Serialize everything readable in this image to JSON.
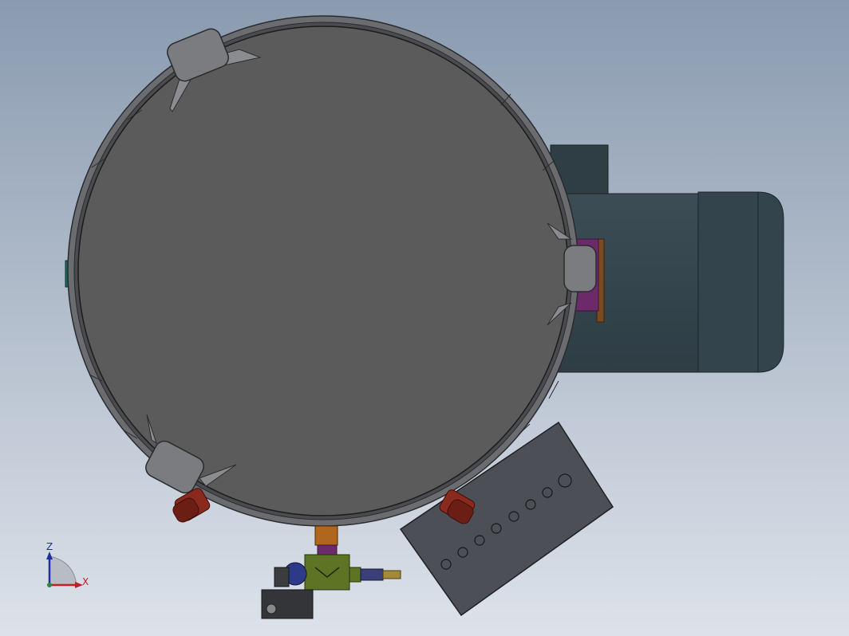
{
  "viewport": {
    "background_top": "#8a9bb0",
    "background_bottom": "#dde2ea"
  },
  "model": {
    "vessel_body": "cylindrical-tank-top-view",
    "drive_motor": "electric-motor-housing",
    "nameplate": "perforated-mounting-plate",
    "valve": "drain-valve-assembly",
    "colors": {
      "vessel_fill": "#5b5b5b",
      "vessel_rim": "#6a6c70",
      "motor_fill": "#36474e",
      "motor_dark": "#2b393f",
      "plate_fill": "#4c4f55",
      "fitting_red": "#8a2a1e",
      "fitting_orange": "#b0661c",
      "valve_green": "#5d7424",
      "valve_blue": "#2d3a8a",
      "flange_purple": "#6d2a6a",
      "connector_teal": "#1d6a60",
      "brass": "#a28a3a"
    }
  },
  "triad": {
    "z_label": "Z",
    "x_label": "X",
    "z_color": "#1f2fa0",
    "x_color": "#c02020"
  }
}
